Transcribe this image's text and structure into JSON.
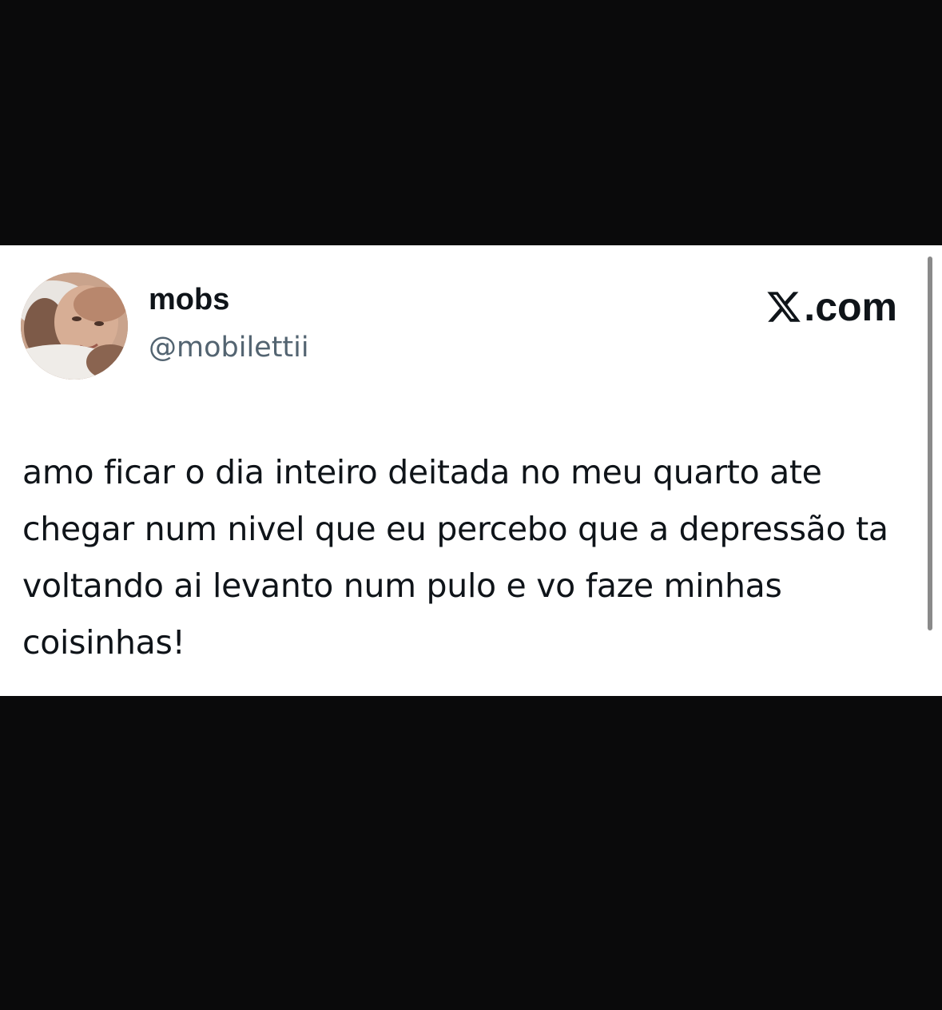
{
  "author": {
    "display_name": "mobs",
    "handle": "@mobilettii",
    "avatar_icon": "avatar-photo"
  },
  "brand": {
    "label": ".com",
    "logo_icon": "x-logo-icon"
  },
  "tweet": {
    "text": "amo ficar o dia inteiro deitada no meu quarto ate chegar num nivel que eu percebo que a depressão ta voltando ai levanto num pulo e vo faze minhas coisinhas!"
  },
  "colors": {
    "background": "#0a0a0b",
    "card": "#ffffff",
    "text_primary": "#0f1419",
    "text_secondary": "#536471"
  }
}
